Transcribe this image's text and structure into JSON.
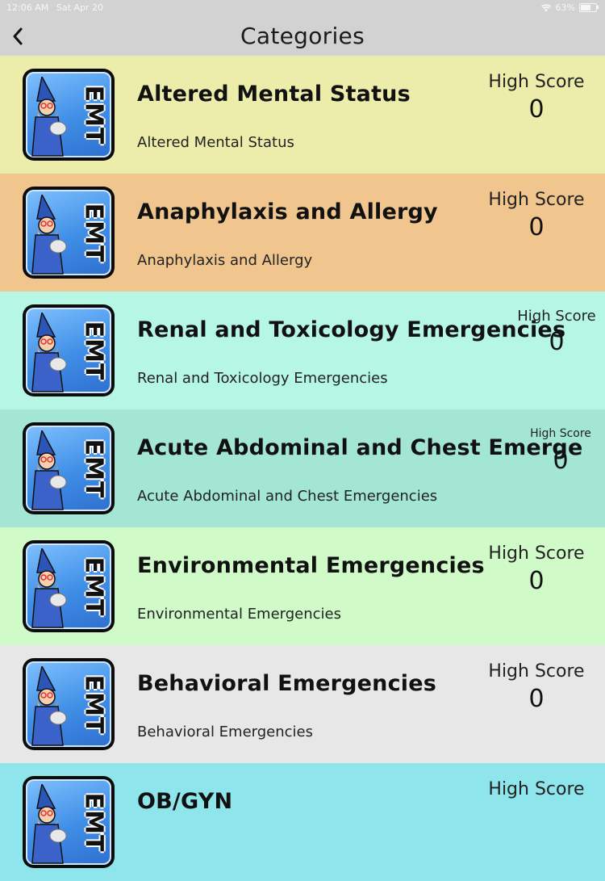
{
  "status_bar": {
    "time": "12:06 AM",
    "date": "Sat Apr 20",
    "battery": "63%"
  },
  "nav": {
    "title": "Categories"
  },
  "icon": {
    "text": "EMT"
  },
  "categories": [
    {
      "title": "Altered Mental Status",
      "subtitle": "Altered Mental Status",
      "score_label": "High Score",
      "score": "0",
      "bg": "#ecedab"
    },
    {
      "title": "Anaphylaxis and Allergy",
      "subtitle": "Anaphylaxis and Allergy",
      "score_label": "High Score",
      "score": "0",
      "bg": "#f0c68e"
    },
    {
      "title": "Renal and Toxicology Emergencies",
      "subtitle": "Renal and Toxicology Emergencies",
      "score_label": "High Score",
      "score": "0",
      "bg": "#b6f6e4"
    },
    {
      "title": "Acute Abdominal and Chest Emerge",
      "subtitle": "Acute Abdominal and Chest Emergencies",
      "score_label": "High Score",
      "score": "0",
      "bg": "#a3e6d3"
    },
    {
      "title": "Environmental Emergencies",
      "subtitle": "Environmental Emergencies",
      "score_label": "High Score",
      "score": "0",
      "bg": "#d0fbc9"
    },
    {
      "title": "Behavioral Emergencies",
      "subtitle": "Behavioral Emergencies",
      "score_label": "High Score",
      "score": "0",
      "bg": "#e7e7e7"
    },
    {
      "title": "OB/GYN",
      "subtitle": "",
      "score_label": "High Score",
      "score": "",
      "bg": "#8fe5ec"
    }
  ]
}
